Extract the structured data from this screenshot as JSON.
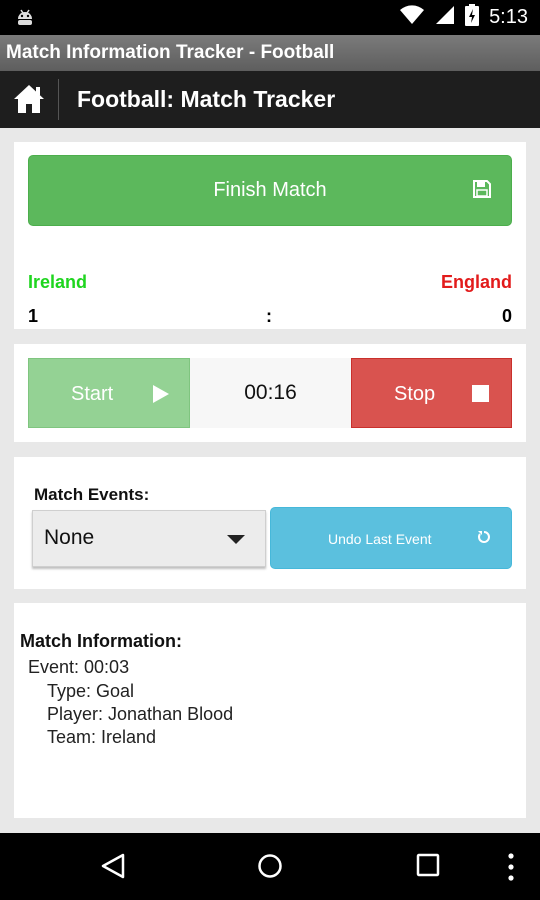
{
  "status_bar": {
    "time": "5:13",
    "icons": [
      "android-debug-icon",
      "wifi-icon",
      "signal-icon",
      "battery-charging-icon"
    ]
  },
  "app": {
    "window_title": "Match Information Tracker - Football",
    "page_title": "Football: Match Tracker"
  },
  "match": {
    "finish_label": "Finish Match",
    "home_team": "Ireland",
    "away_team": "England",
    "home_score": "1",
    "separator": ":",
    "away_score": "0"
  },
  "timer": {
    "start_label": "Start",
    "time": "00:16",
    "stop_label": "Stop"
  },
  "events": {
    "label": "Match Events:",
    "selected": "None",
    "undo_label": "Undo Last Event"
  },
  "info": {
    "title": "Match Information:",
    "event": "Event: 00:03",
    "type": "Type: Goal",
    "player": "Player: Jonathan Blood",
    "team": "Team: Ireland"
  },
  "colors": {
    "success": "#5cb85c",
    "danger": "#d9534f",
    "info": "#5bc0de",
    "home_team": "#1fd51f",
    "away_team": "#e21b1b"
  }
}
